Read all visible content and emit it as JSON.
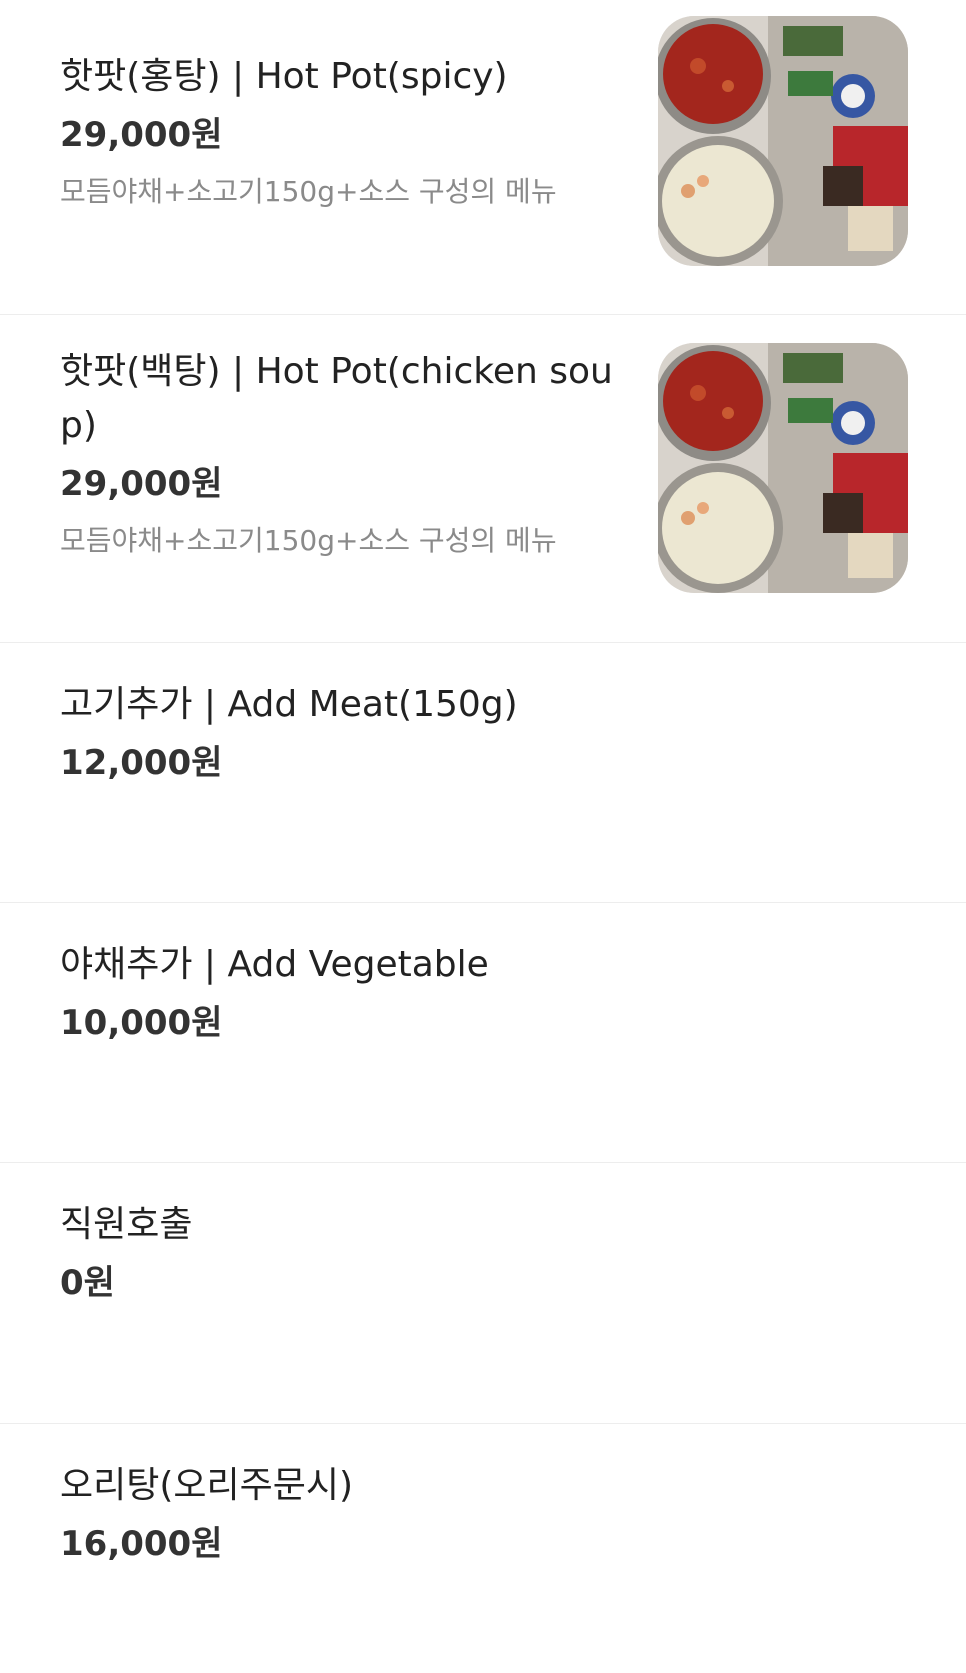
{
  "menu": {
    "items": [
      {
        "name": "핫팟(홍탕) | Hot Pot(spicy)",
        "price": "29,000원",
        "description": "모듬야채+소고기150g+소스 구성의 메뉴",
        "image": "hot-pot-photo"
      },
      {
        "name": "핫팟(백탕) | Hot Pot(chicken soup)",
        "price": "29,000원",
        "description": "모듬야채+소고기150g+소스 구성의 메뉴",
        "image": "hot-pot-photo"
      },
      {
        "name": "고기추가 | Add Meat(150g)",
        "price": "12,000원"
      },
      {
        "name": "야채추가 | Add Vegetable",
        "price": "10,000원"
      },
      {
        "name": "직원호출",
        "price": "0원"
      },
      {
        "name": "오리탕(오리주문시)",
        "price": "16,000원"
      }
    ]
  }
}
